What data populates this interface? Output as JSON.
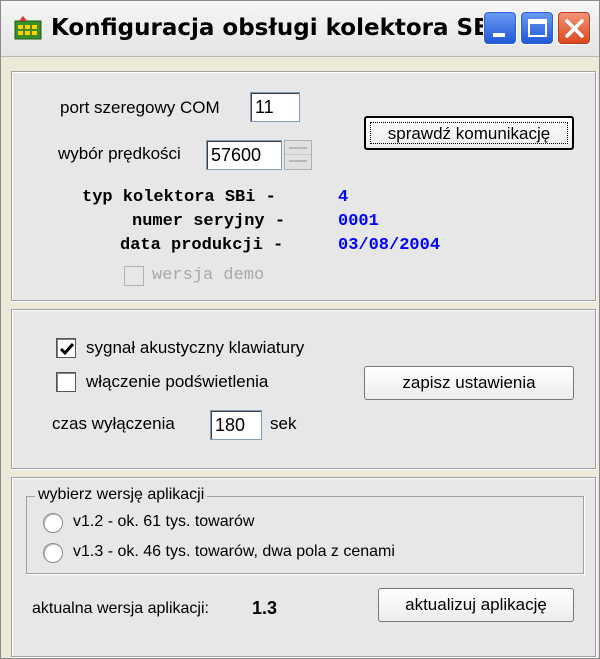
{
  "window": {
    "title": "Konfiguracja obsługi kolektora SBi"
  },
  "connection": {
    "port_label": "port szeregowy COM",
    "port_value": "11",
    "speed_label": "wybór prędkości",
    "speed_value": "57600",
    "check_button": "sprawdź komunikację"
  },
  "collector": {
    "type_label": "typ kolektora SBi - ",
    "type_value": "4",
    "serial_label": "numer seryjny - ",
    "serial_value": "0001",
    "date_label": "data produkcji - ",
    "date_value": "03/08/2004",
    "demo_label": "wersja demo",
    "demo_checked": false
  },
  "settings": {
    "beep_label": "sygnał akustyczny klawiatury",
    "beep_checked": true,
    "backlight_label": "włączenie podświetlenia",
    "backlight_checked": false,
    "timeout_label": "czas wyłączenia",
    "timeout_value": "180",
    "timeout_unit": "sek",
    "save_button": "zapisz ustawienia"
  },
  "app_version": {
    "group_label": "wybierz wersję aplikacji",
    "option1": "v1.2 - ok. 61 tys. towarów",
    "option2": "v1.3 - ok. 46 tys. towarów, dwa pola z cenami",
    "current_label": "aktualna wersja aplikacji:",
    "current_value": "1.3",
    "update_button": "aktualizuj aplikację"
  },
  "colors": {
    "accent_blue": "#0000ff",
    "titlebar_button": "#1e56d6",
    "close_button": "#d9461c"
  }
}
